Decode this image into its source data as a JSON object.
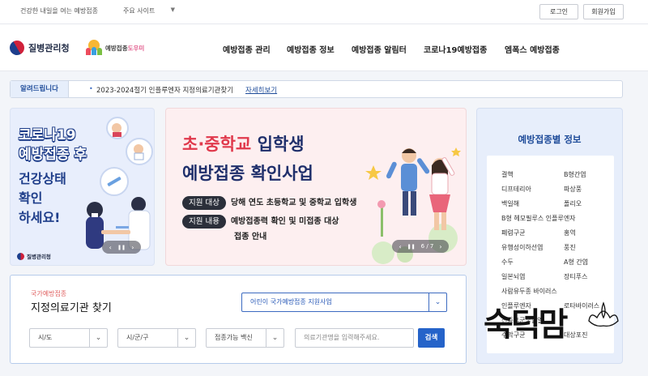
{
  "topbar": {
    "tagline": "건강한 내일을 여는 예방접종",
    "sites_label": "주요 사이트",
    "login": "로그인",
    "join": "회원가입"
  },
  "header": {
    "org_name": "질병관리청",
    "helper_name_a": "예방접종",
    "helper_name_b": "도우미",
    "nav": [
      "예방접종 관리",
      "예방접종 정보",
      "예방접종 알림터",
      "코로나19예방접종",
      "엠폭스 예방접종"
    ]
  },
  "notice": {
    "badge": "알려드립니다",
    "message": "2023-2024절기 인플루엔자 지정의료기관찾기",
    "more": "자세히보기"
  },
  "banner_left": {
    "lines": [
      "코로나19",
      "예방접종 후",
      "건강상태",
      "확인",
      "하세요!"
    ],
    "footer": "질병관리청",
    "ctl_prev": "‹",
    "ctl_pause": "❚❚",
    "ctl_next": "›"
  },
  "banner_center": {
    "title_a": "초·중학교",
    "title_b": " 입학생",
    "title_line2": "예방접종 확인사업",
    "target_label": "지원 대상",
    "target_text": "당해 연도 초등학교 및 중학교 입학생",
    "content_label": "지원 내용",
    "content_text": "예방접종력 확인 및 미접종 대상",
    "content_text2": "접종 안내",
    "ctl_prev": "‹",
    "ctl_pause": "❚❚",
    "ctl_page": "6 / 7",
    "ctl_next": "›"
  },
  "side": {
    "title": "예방접종별 정보",
    "items_left": [
      "결핵",
      "디프테리아",
      "백일해",
      "B형 헤모필루스 인플루엔자",
      "폐렴구균",
      "유행성이하선염",
      "수두",
      "일본뇌염",
      "사람유두종 바이러스",
      "인플루엔자",
      "신증후군출혈열",
      "수막구균"
    ],
    "items_right": [
      "B형간염",
      "파상풍",
      "폴리오",
      "",
      "홍역",
      "풍진",
      "A형 간염",
      "장티푸스",
      "",
      "로타바이러스",
      "",
      "대상포진"
    ]
  },
  "search": {
    "subtitle": "국가예방접종",
    "title": "지정의료기관 찾기",
    "program_select": "어린이 국가예방접종 지원사업",
    "sido": "시/도",
    "sigungu": "시/군/구",
    "vaccine": "접종가능 백신",
    "name_placeholder": "의료기관명을 입력해주세요.",
    "submit": "검색"
  },
  "watermark": {
    "text": "숙덕맘"
  },
  "colors": {
    "primary": "#2563c9",
    "accent_red": "#e0394c",
    "navy": "#1f2f6b"
  }
}
